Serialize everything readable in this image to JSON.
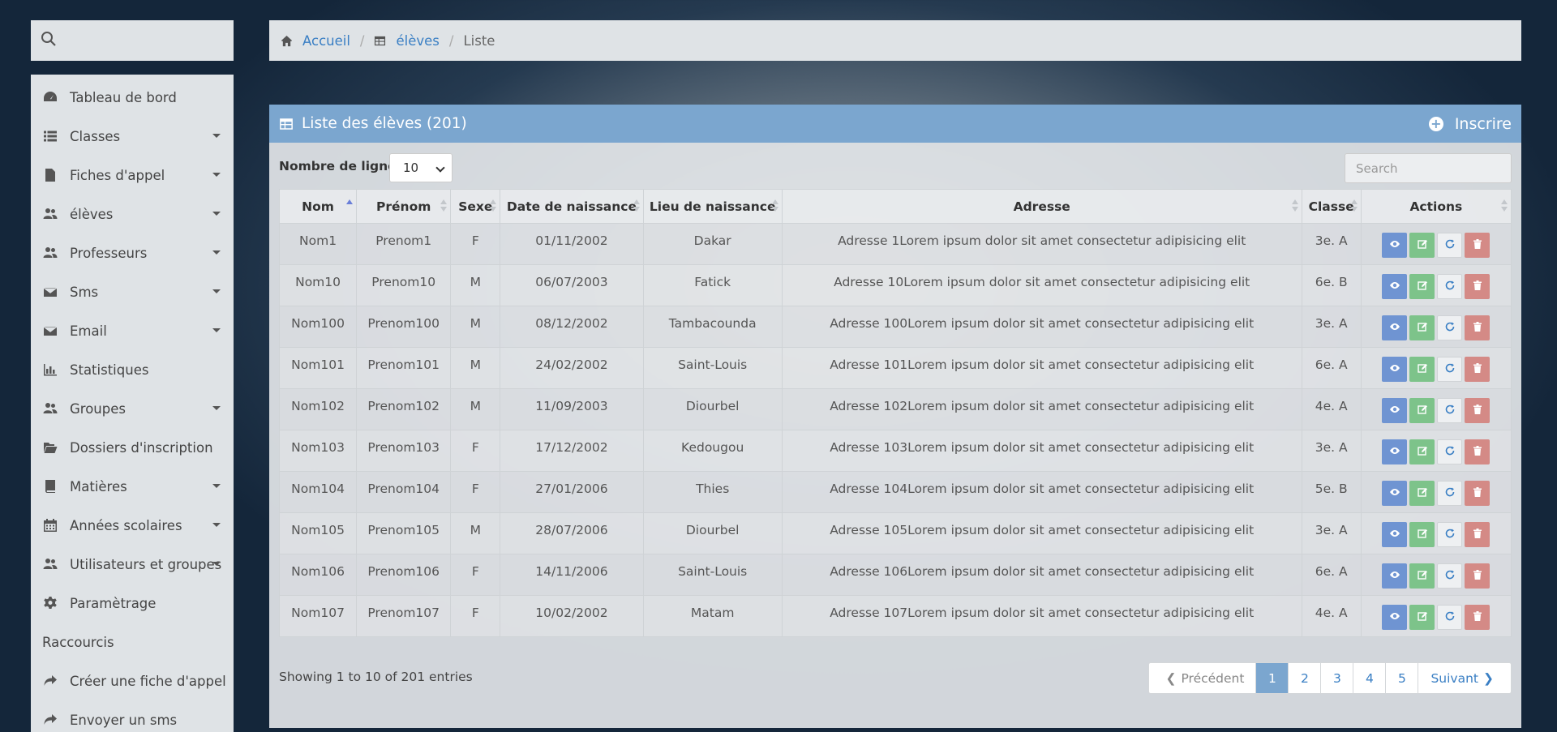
{
  "sidebar": {
    "items": [
      {
        "label": "Tableau de bord",
        "icon": "dashboard-icon",
        "caret": false
      },
      {
        "label": "Classes",
        "icon": "list-icon",
        "caret": true
      },
      {
        "label": "Fiches d'appel",
        "icon": "file-icon",
        "caret": true
      },
      {
        "label": "élèves",
        "icon": "users-icon",
        "caret": true
      },
      {
        "label": "Professeurs",
        "icon": "users-icon",
        "caret": true
      },
      {
        "label": "Sms",
        "icon": "envelope-icon",
        "caret": true
      },
      {
        "label": "Email",
        "icon": "envelope-icon",
        "caret": true
      },
      {
        "label": "Statistiques",
        "icon": "bar-chart-icon",
        "caret": false
      },
      {
        "label": "Groupes",
        "icon": "users-icon",
        "caret": true
      },
      {
        "label": "Dossiers d'inscription",
        "icon": "folder-open-icon",
        "caret": false
      },
      {
        "label": "Matières",
        "icon": "book-icon",
        "caret": true
      },
      {
        "label": "Années scolaires",
        "icon": "calendar-icon",
        "caret": true
      },
      {
        "label": "Utilisateurs et groupes",
        "icon": "users-icon",
        "caret": true
      },
      {
        "label": "Paramètrage",
        "icon": "gear-icon",
        "caret": false
      }
    ],
    "shortcuts_header": "Raccourcis",
    "shortcuts": [
      {
        "label": "Créer une fiche d'appel",
        "icon": "share-icon"
      },
      {
        "label": "Envoyer un sms",
        "icon": "share-icon"
      }
    ]
  },
  "breadcrumb": {
    "home": "Accueil",
    "section": "élèves",
    "current": "Liste"
  },
  "panel": {
    "title": "Liste des élèves (201)",
    "add_label": "Inscrire"
  },
  "controls": {
    "lines_label": "Nombre de lignes :",
    "lines_value": "10",
    "search_placeholder": "Search"
  },
  "table": {
    "columns": [
      "Nom",
      "Prénom",
      "Sexe",
      "Date de naissance",
      "Lieu de naissance",
      "Adresse",
      "Classe",
      "Actions"
    ],
    "rows": [
      [
        "Nom1",
        "Prenom1",
        "F",
        "01/11/2002",
        "Dakar",
        "Adresse 1Lorem ipsum dolor sit amet consectetur adipisicing elit",
        "3e. A"
      ],
      [
        "Nom10",
        "Prenom10",
        "M",
        "06/07/2003",
        "Fatick",
        "Adresse 10Lorem ipsum dolor sit amet consectetur adipisicing elit",
        "6e. B"
      ],
      [
        "Nom100",
        "Prenom100",
        "M",
        "08/12/2002",
        "Tambacounda",
        "Adresse 100Lorem ipsum dolor sit amet consectetur adipisicing elit",
        "3e. A"
      ],
      [
        "Nom101",
        "Prenom101",
        "M",
        "24/02/2002",
        "Saint-Louis",
        "Adresse 101Lorem ipsum dolor sit amet consectetur adipisicing elit",
        "6e. A"
      ],
      [
        "Nom102",
        "Prenom102",
        "M",
        "11/09/2003",
        "Diourbel",
        "Adresse 102Lorem ipsum dolor sit amet consectetur adipisicing elit",
        "4e. A"
      ],
      [
        "Nom103",
        "Prenom103",
        "F",
        "17/12/2002",
        "Kedougou",
        "Adresse 103Lorem ipsum dolor sit amet consectetur adipisicing elit",
        "3e. A"
      ],
      [
        "Nom104",
        "Prenom104",
        "F",
        "27/01/2006",
        "Thies",
        "Adresse 104Lorem ipsum dolor sit amet consectetur adipisicing elit",
        "5e. B"
      ],
      [
        "Nom105",
        "Prenom105",
        "M",
        "28/07/2006",
        "Diourbel",
        "Adresse 105Lorem ipsum dolor sit amet consectetur adipisicing elit",
        "3e. A"
      ],
      [
        "Nom106",
        "Prenom106",
        "F",
        "14/11/2006",
        "Saint-Louis",
        "Adresse 106Lorem ipsum dolor sit amet consectetur adipisicing elit",
        "6e. A"
      ],
      [
        "Nom107",
        "Prenom107",
        "F",
        "10/02/2002",
        "Matam",
        "Adresse 107Lorem ipsum dolor sit amet consectetur adipisicing elit",
        "4e. A"
      ]
    ]
  },
  "footer": {
    "info": "Showing 1 to 10 of 201 entries",
    "prev": "Précédent",
    "pages": [
      "1",
      "2",
      "3",
      "4",
      "5"
    ],
    "active_page": "1",
    "next": "Suivant"
  },
  "colors": {
    "panel_header": "#7ba6cf",
    "link": "#3a7fc4",
    "view_button": "#6f94d2",
    "edit_button": "#7dc38a",
    "delete_button": "#d48a86"
  }
}
